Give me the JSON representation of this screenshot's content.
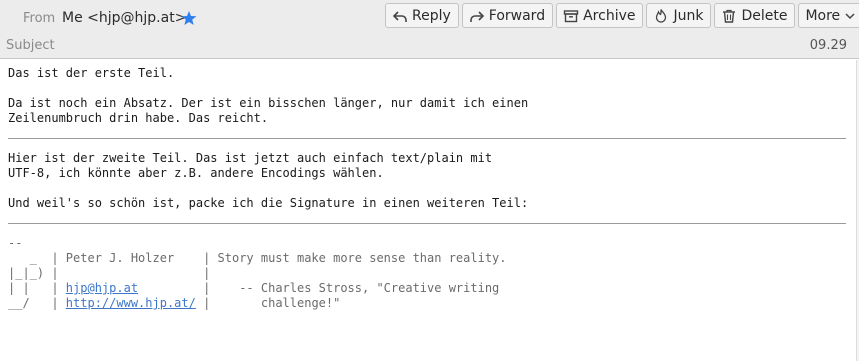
{
  "header": {
    "from_label": "From",
    "from_value": "Me <hjp@hjp.at>",
    "subject_label": "Subject",
    "date": "09.29",
    "star_color": "#2f80ed"
  },
  "toolbar": {
    "reply": "Reply",
    "forward": "Forward",
    "archive": "Archive",
    "junk": "Junk",
    "delete": "Delete",
    "more": "More"
  },
  "message": {
    "part1_line1": "Das ist der erste Teil.",
    "part1_line2": "Da ist noch ein Absatz. Der ist ein bisschen länger, nur damit ich einen",
    "part1_line3": "Zeilenumbruch drin habe. Das reicht.",
    "part2_line1": "Hier ist der zweite Teil. Das ist jetzt auch einfach text/plain mit",
    "part2_line2": "UTF-8, ich könnte aber z.B. andere Encodings wählen.",
    "part2_line3": "Und weil's so schön ist, packe ich die Signature in einen weiteren Teil:"
  },
  "signature": {
    "dashes": "--",
    "line1_prefix": "   _  | Peter J. Holzer    | Story must make more sense than reality.",
    "line2": "|_|_) |                    |",
    "line3_prefix": "| |   | ",
    "email_link": "hjp@hjp.at",
    "line3_suffix": "         |    -- Charles Stross, \"Creative writing",
    "line4_prefix": "__/   | ",
    "url_link": "http://www.hjp.at/",
    "line4_suffix": " |       challenge!\""
  }
}
